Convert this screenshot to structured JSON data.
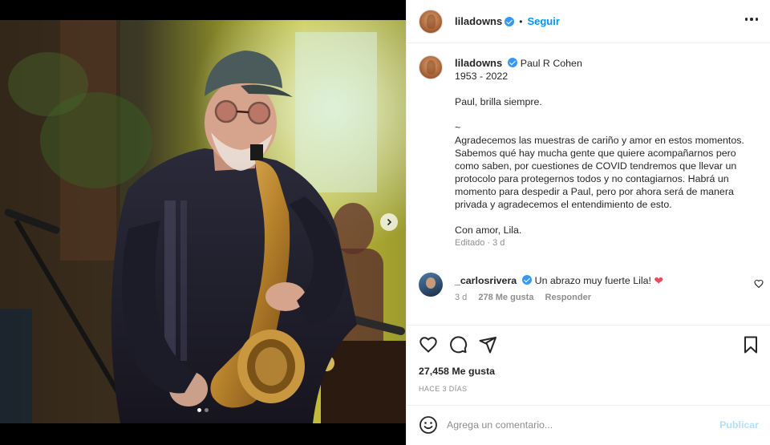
{
  "post": {
    "account": {
      "username": "liladowns",
      "verified": true,
      "follow_label": "Seguir",
      "separator": "•"
    },
    "caption": {
      "username": "liladowns",
      "lines": [
        "Paul R Cohen",
        "1953 - 2022",
        "",
        "Paul, brilla siempre.",
        "",
        "~",
        "Agradecemos las muestras de cariño y amor en estos momentos.",
        "Sabemos qué hay mucha gente que quiere acompañarnos pero",
        "como saben, por cuestiones de COVID tendremos que llevar un",
        "protocolo para protegernos todos y no contagiarnos. Habrá un",
        "momento para despedir a Paul, pero por ahora será de manera",
        "privada y agradecemos el entendimiento de esto.",
        "",
        "Con amor, Lila."
      ],
      "meta": "Editado · 3 d"
    },
    "comment": {
      "username": "_carlosrivera",
      "verified": true,
      "text": "Un abrazo muy fuerte Lila!",
      "emoji": "❤",
      "time": "3 d",
      "likes": "278 Me gusta",
      "reply_label": "Responder"
    },
    "likes_text": "27,458 Me gusta",
    "time_ago": "HACE 3 DÍAS",
    "add_comment": {
      "placeholder": "Agrega un comentario...",
      "publish_label": "Publicar"
    },
    "carousel": {
      "current": 1,
      "total": 2
    }
  },
  "colors": {
    "accent": "#0095f6",
    "verified": "#3897f0",
    "heart": "#ed4956",
    "muted": "#8e8e8e",
    "publish_disabled": "#b2dffc"
  },
  "icons": [
    "more-options-icon",
    "verified-badge-icon",
    "like-heart-icon",
    "comment-icon",
    "share-icon",
    "bookmark-icon",
    "emoji-icon",
    "next-arrow-icon",
    "small-heart-icon"
  ]
}
